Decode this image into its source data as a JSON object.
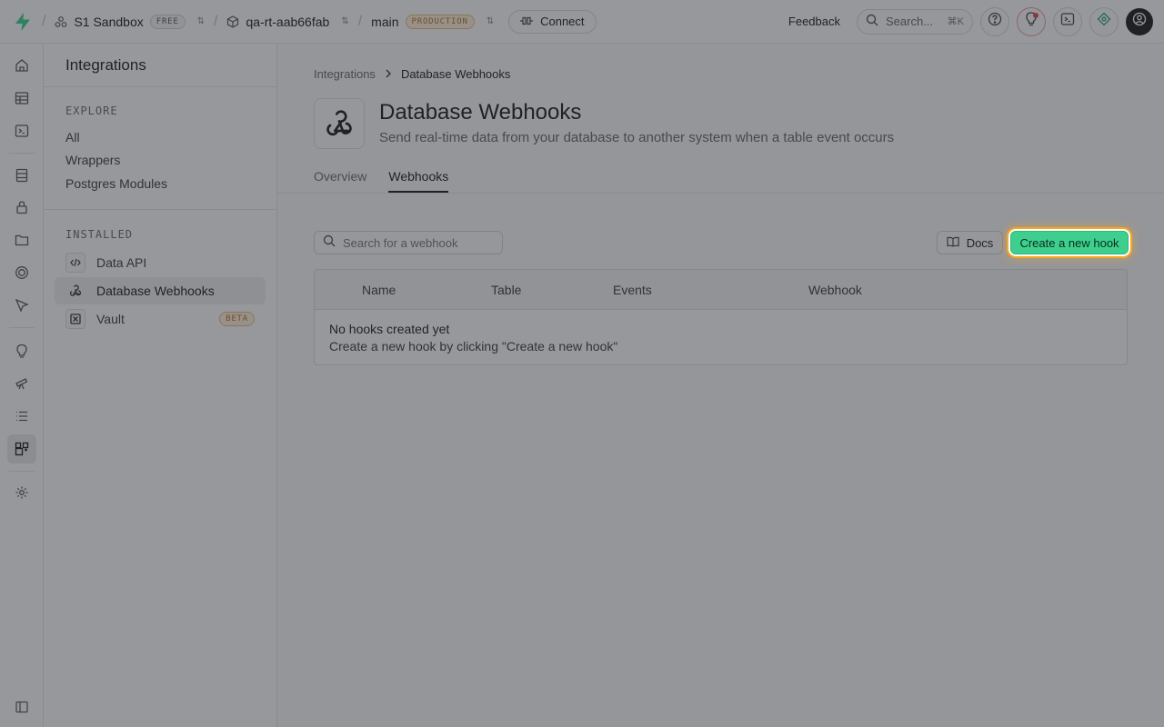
{
  "topbar": {
    "org_name": "S1 Sandbox",
    "org_plan": "FREE",
    "project_name": "qa-rt-aab66fab",
    "branch_name": "main",
    "branch_badge": "PRODUCTION",
    "connect_label": "Connect",
    "feedback_label": "Feedback",
    "search_placeholder": "Search...",
    "search_shortcut": "⌘K"
  },
  "sidebar": {
    "title": "Integrations",
    "explore_heading": "EXPLORE",
    "explore_links": [
      "All",
      "Wrappers",
      "Postgres Modules"
    ],
    "installed_heading": "INSTALLED",
    "installed_items": [
      {
        "label": "Data API"
      },
      {
        "label": "Database Webhooks"
      },
      {
        "label": "Vault",
        "badge": "BETA"
      }
    ]
  },
  "main": {
    "breadcrumb": [
      "Integrations",
      "Database Webhooks"
    ],
    "title": "Database Webhooks",
    "subtitle": "Send real-time data from your database to another system when a table event occurs",
    "tabs": [
      "Overview",
      "Webhooks"
    ],
    "active_tab": "Webhooks",
    "search_placeholder": "Search for a webhook",
    "docs_label": "Docs",
    "create_label": "Create a new hook",
    "table": {
      "columns": [
        "Name",
        "Table",
        "Events",
        "Webhook"
      ],
      "empty_title": "No hooks created yet",
      "empty_subtitle": "Create a new hook by clicking \"Create a new hook\""
    }
  },
  "colors": {
    "brand_green": "#3ecf8e",
    "highlight_orange": "#f5a623",
    "production_badge": "#b86f1a"
  }
}
